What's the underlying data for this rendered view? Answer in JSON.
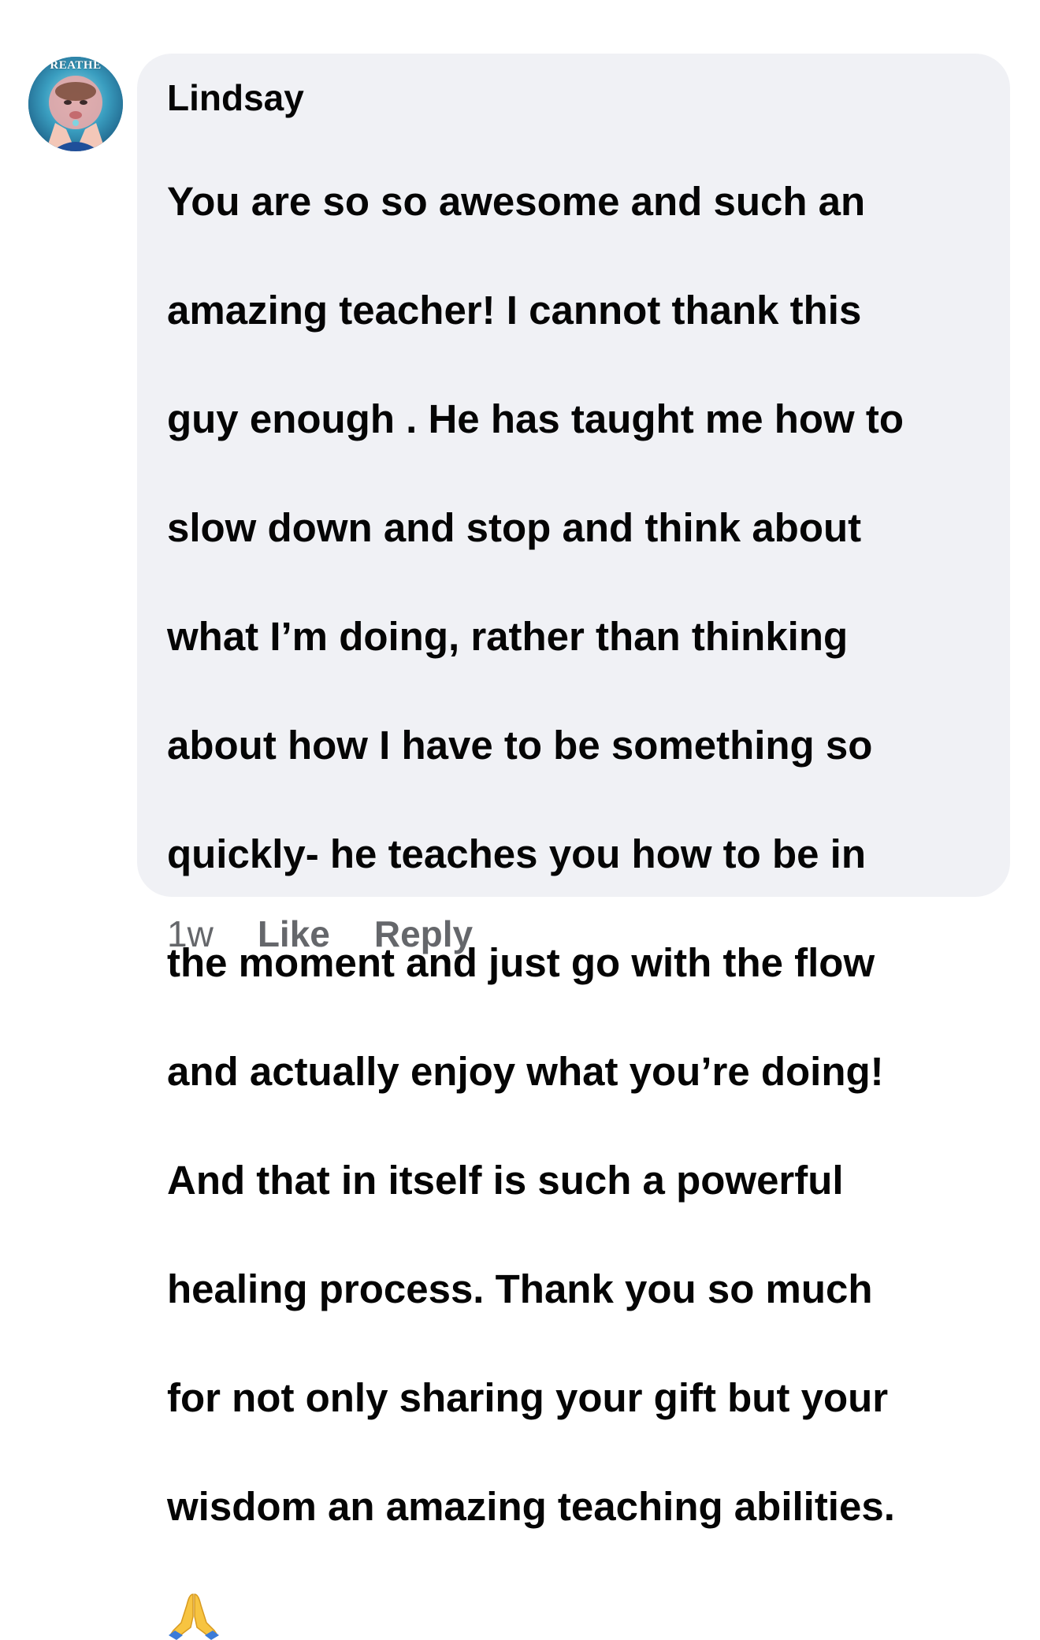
{
  "comment": {
    "avatar_label": "REATHE",
    "author": "Lindsay",
    "text_lines": [
      "You are so so awesome and such an",
      "amazing teacher! I cannot thank this",
      "guy enough . He has taught me how to",
      "slow down and stop and think about",
      "what I’m doing, rather than thinking",
      "about how I have to be something so",
      "quickly-  he teaches you how to be in",
      "the moment and just go with the flow",
      "and actually enjoy what you’re doing!",
      "And that in itself is such a powerful",
      "healing process. Thank you so much",
      "for not only sharing your gift but your",
      "wisdom an amazing teaching abilities."
    ],
    "emoji": "folded-hands-emoji",
    "timestamp": "1w",
    "like_label": "Like",
    "reply_label": "Reply"
  },
  "colors": {
    "bubble_background": "#f0f1f5",
    "text": "#050505",
    "secondary_text": "#65676b",
    "page_background": "#ffffff"
  }
}
